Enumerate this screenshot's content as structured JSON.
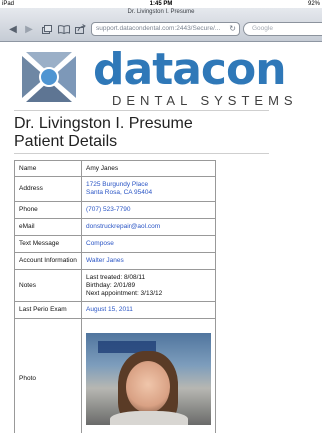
{
  "status_bar": {
    "device": "iPad",
    "time": "1:45 PM",
    "battery": "92%"
  },
  "browser": {
    "page_title": "Dr. Livingston I. Presume",
    "url": "support.datacondental.com:2443/Secure/...",
    "search_placeholder": "Google"
  },
  "logo": {
    "wordmark": "datacon",
    "tagline": "DENTAL SYSTEMS"
  },
  "heading": {
    "line1": "Dr. Livingston I. Presume",
    "line2": "Patient Details"
  },
  "details": {
    "name": {
      "label": "Name",
      "value": "Amy Janes"
    },
    "address": {
      "label": "Address",
      "line1": "1725 Burgundy Place",
      "line2": "Santa Rosa, CA 95404"
    },
    "phone": {
      "label": "Phone",
      "value": "(707) 523-7790"
    },
    "email": {
      "label": "eMail",
      "value": "donstruckrepair@aol.com"
    },
    "text_message": {
      "label": "Text Message",
      "value": "Compose"
    },
    "account": {
      "label": "Account Information",
      "value": "Walter Janes"
    },
    "notes": {
      "label": "Notes",
      "line1": "Last treated: 8/08/11",
      "line2": "Birthday: 2/01/89",
      "line3": "Next appointment: 3/13/12"
    },
    "perio": {
      "label": "Last Perio Exam",
      "value": "August 15, 2011"
    },
    "photo": {
      "label": "Photo"
    }
  },
  "colors": {
    "brand_blue": "#2f78b8",
    "link_blue": "#2a55c5"
  }
}
